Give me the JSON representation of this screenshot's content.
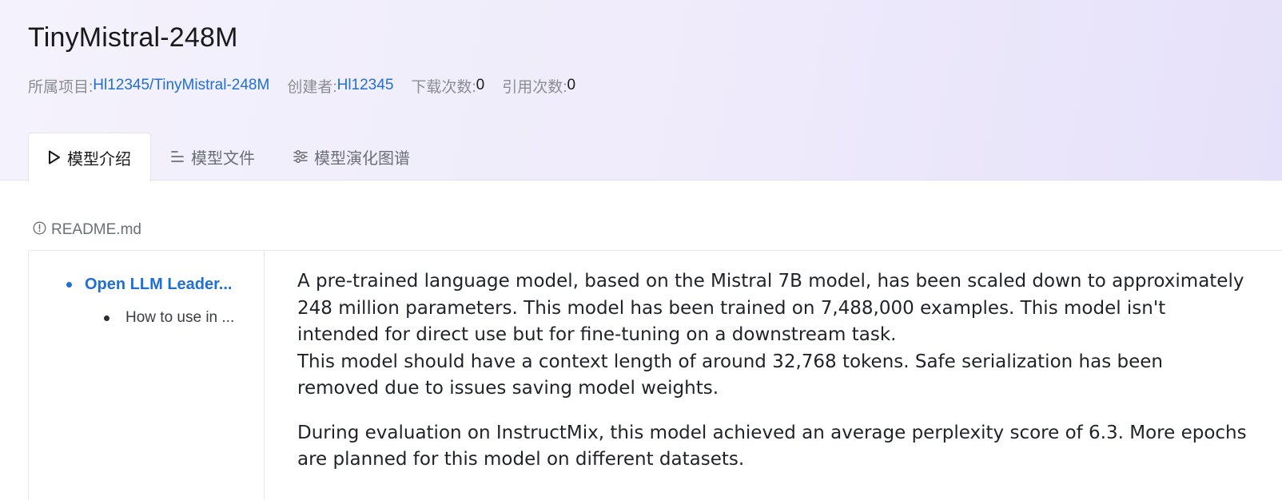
{
  "header": {
    "title": "TinyMistral-248M",
    "meta": {
      "project_label": "所属项目:",
      "project_value": "Hl12345/TinyMistral-248M",
      "creator_label": "创建者:",
      "creator_value": "Hl12345",
      "downloads_label": "下载次数:",
      "downloads_value": "0",
      "citations_label": "引用次数:",
      "citations_value": "0"
    }
  },
  "tabs": [
    {
      "label": "模型介绍",
      "icon": "play-triangle-icon",
      "active": true
    },
    {
      "label": "模型文件",
      "icon": "file-lines-icon",
      "active": false
    },
    {
      "label": "模型演化图谱",
      "icon": "sliders-icon",
      "active": false
    }
  ],
  "readme": {
    "icon": "info-circle-icon",
    "filename": "README.md"
  },
  "toc": {
    "items": [
      {
        "label": "Open LLM Leader...",
        "level": 1,
        "active": true
      },
      {
        "label": "How to use in ...",
        "level": 2,
        "active": false
      }
    ]
  },
  "content": {
    "paragraphs": [
      "A pre-trained language model, based on the Mistral 7B model, has been scaled down to approximately 248 million parameters. This model has been trained on 7,488,000 examples. This model isn't intended for direct use but for fine-tuning on a downstream task.",
      "This model should have a context length of around 32,768 tokens. Safe serialization has been removed due to issues saving model weights.",
      "During evaluation on InstructMix, this model achieved an average perplexity score of 6.3. More epochs are planned for this model on different datasets."
    ]
  },
  "colors": {
    "link": "#1f6fd6",
    "header_bg": "#efebfb",
    "border": "#e5e6eb"
  }
}
